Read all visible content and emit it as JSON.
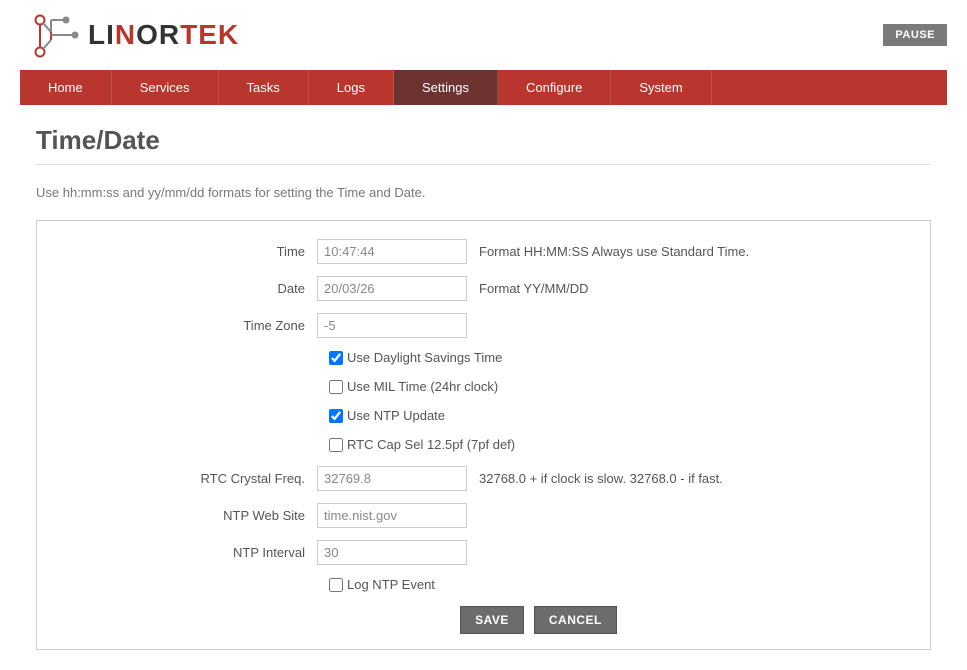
{
  "header": {
    "brand_part1": "LI",
    "brand_part2": "N",
    "brand_part3": "OR",
    "brand_part4": "TEK",
    "pause_label": "PAUSE"
  },
  "nav": {
    "items": [
      {
        "label": "Home"
      },
      {
        "label": "Services"
      },
      {
        "label": "Tasks"
      },
      {
        "label": "Logs"
      },
      {
        "label": "Settings"
      },
      {
        "label": "Configure"
      },
      {
        "label": "System"
      }
    ]
  },
  "page": {
    "title": "Time/Date",
    "hint": "Use hh:mm:ss and yy/mm/dd formats for setting the Time and Date."
  },
  "form": {
    "time_label": "Time",
    "time_value": "10:47:44",
    "time_help": "Format HH:MM:SS Always use Standard Time.",
    "date_label": "Date",
    "date_value": "20/03/26",
    "date_help": "Format YY/MM/DD",
    "tz_label": "Time Zone",
    "tz_value": "-5",
    "dst_label": "Use Daylight Savings Time",
    "mil_label": "Use MIL Time (24hr clock)",
    "ntp_label": "Use NTP Update",
    "rtccap_label": "RTC Cap Sel 12.5pf (7pf def)",
    "freq_label": "RTC Crystal Freq.",
    "freq_value": "32769.8",
    "freq_help": "32768.0 + if clock is slow. 32768.0 - if fast.",
    "ntpweb_label": "NTP Web Site",
    "ntpweb_value": "time.nist.gov",
    "ntpint_label": "NTP Interval",
    "ntpint_value": "30",
    "logntp_label": "Log NTP Event",
    "save_label": "SAVE",
    "cancel_label": "CANCEL"
  }
}
